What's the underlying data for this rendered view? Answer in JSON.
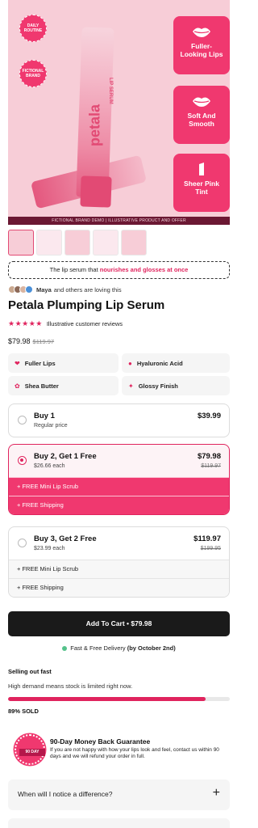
{
  "hero": {
    "badge_top": "DAILY ROUTINE",
    "badge_bottom": "FICTIONAL BRAND",
    "brand": "petala",
    "tube_sub": "LIP SERUM",
    "benefits": [
      "Fuller-Looking Lips",
      "Soft And Smooth",
      "Sheer Pink Tint"
    ],
    "caption": "FICTIONAL BRAND DEMO | ILLUSTRATIVE PRODUCT AND OFFER"
  },
  "promo": {
    "prefix": "The lip serum that ",
    "highlight": "nourishes and glosses at once"
  },
  "social": {
    "name": "Maya",
    "text": "and others are loving this"
  },
  "product": {
    "title": "Petala Plumping Lip Serum",
    "stars": "★★★★★",
    "reviews_label": "Illustrative customer reviews",
    "price": "$79.98",
    "compare_price": "$119.97"
  },
  "features": [
    {
      "icon": "lips-icon",
      "glyph": "❤",
      "label": "Fuller Lips"
    },
    {
      "icon": "drop-icon",
      "glyph": "💧",
      "label": "Hyaluronic Acid"
    },
    {
      "icon": "butter-icon",
      "glyph": "✿",
      "label": "Shea Butter"
    },
    {
      "icon": "gloss-icon",
      "glyph": "✦",
      "label": "Glossy Finish"
    }
  ],
  "bundles": [
    {
      "name": "Buy 1",
      "sub": "Regular price",
      "price": "$39.99",
      "old": "",
      "bonuses": [],
      "selected": false
    },
    {
      "name": "Buy 2, Get 1 Free",
      "sub": "$26.66 each",
      "price": "$79.98",
      "old": "$119.97",
      "bonuses": [
        "+ FREE Mini Lip Scrub",
        "+ FREE Shipping"
      ],
      "selected": true
    },
    {
      "name": "Buy 3, Get 2 Free",
      "sub": "$23.99 each",
      "price": "$119.97",
      "old": "$199.95",
      "bonuses": [
        "+ FREE Mini Lip Scrub",
        "+ FREE Shipping"
      ],
      "selected": false
    }
  ],
  "cta": {
    "label": "Add To Cart • $79.98"
  },
  "delivery": {
    "prefix": "Fast & Free Delivery ",
    "date": "(by October 2nd)"
  },
  "stock": {
    "heading": "Selling out fast",
    "text": "High demand means stock is limited right now.",
    "sold_fraction": 0.89,
    "sold_label": "89% SOLD"
  },
  "guarantee": {
    "seal": "90 DAY",
    "title": "90-Day Money Back Guarantee",
    "text": "If you are not happy with how your lips look and feel, contact us within 90 days and we will refund your order in full."
  },
  "faq": [
    {
      "question": "When will I notice a difference?"
    }
  ],
  "colors": {
    "accent": "#e0245e",
    "accent_light": "#f0386f",
    "dark": "#1a1a1a",
    "hero_bg": "#f7cdd7"
  }
}
